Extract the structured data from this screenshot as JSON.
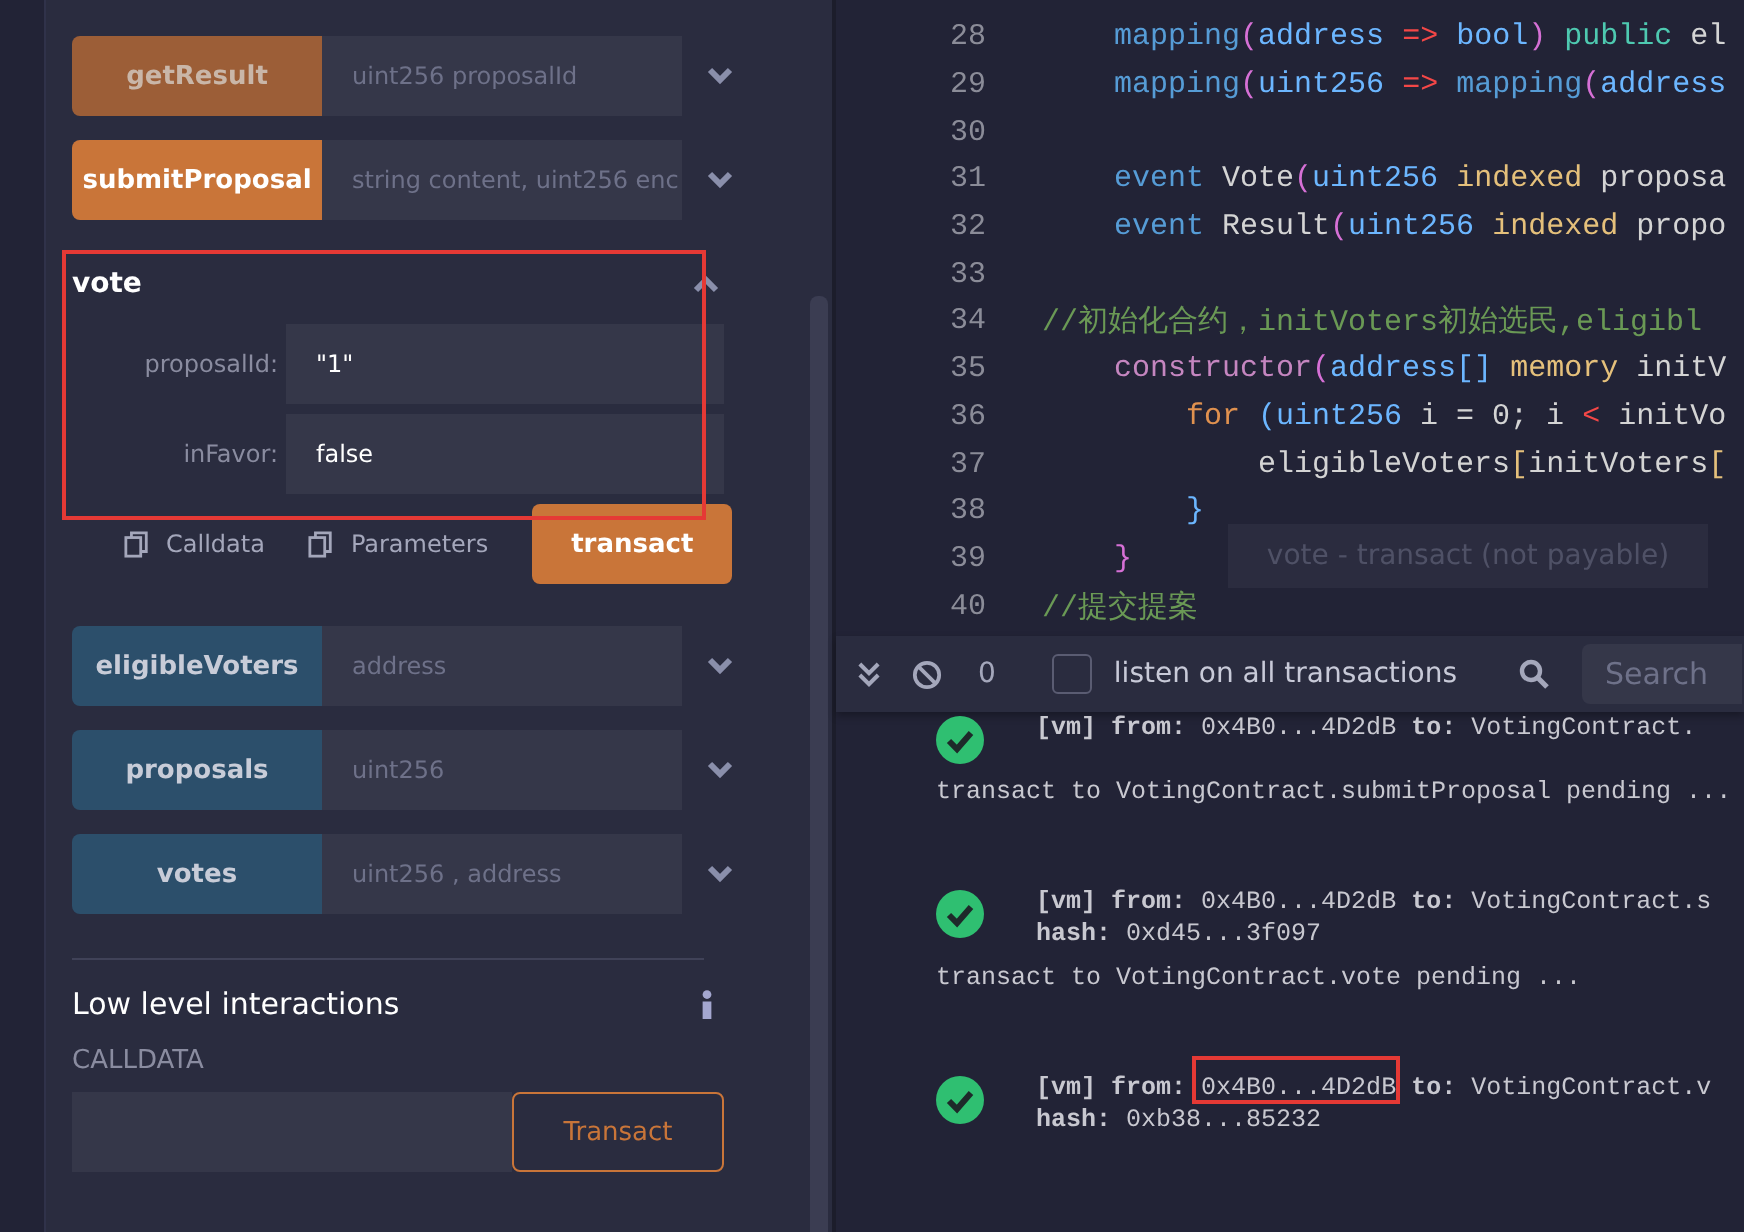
{
  "functions": [
    {
      "name": "getResult",
      "kind": "muted",
      "expanded": false,
      "placeholder": "uint256 proposalId"
    },
    {
      "name": "submitProposal",
      "kind": "transact",
      "expanded": false,
      "placeholder": "string content, uint256 enc"
    },
    {
      "name": "vote",
      "kind": "transact",
      "expanded": true,
      "params": [
        {
          "label": "proposalId:",
          "value": "\"1\""
        },
        {
          "label": "inFavor:",
          "value": "false"
        }
      ],
      "actions": [
        "Calldata",
        "Parameters"
      ],
      "button": "transact"
    },
    {
      "name": "eligibleVoters",
      "kind": "call",
      "expanded": false,
      "placeholder": "address"
    },
    {
      "name": "proposals",
      "kind": "call",
      "expanded": false,
      "placeholder": "uint256"
    },
    {
      "name": "votes",
      "kind": "call",
      "expanded": false,
      "placeholder": "uint256 , address"
    }
  ],
  "low_level": {
    "title": "Low level interactions",
    "label": "CALLDATA",
    "button": "Transact"
  },
  "tooltip": "vote - transact (not payable)",
  "editor": {
    "lines": [
      {
        "number": "28",
        "tokens": [
          {
            "t": "    mapping",
            "kind": "kw"
          },
          {
            "t": "(",
            "kind": "paren"
          },
          {
            "t": "address ",
            "kind": "type"
          },
          {
            "t": "=>",
            "kind": "op"
          },
          {
            "t": " bool",
            "kind": "type"
          },
          {
            "t": ")",
            "kind": "paren"
          },
          {
            "t": " public",
            "kind": "pub"
          },
          {
            "t": " el",
            "kind": "id"
          }
        ]
      },
      {
        "number": "29",
        "tokens": [
          {
            "t": "    mapping",
            "kind": "kw"
          },
          {
            "t": "(",
            "kind": "paren"
          },
          {
            "t": "uint256 ",
            "kind": "type"
          },
          {
            "t": "=>",
            "kind": "op"
          },
          {
            "t": " mapping",
            "kind": "kw"
          },
          {
            "t": "(",
            "kind": "paren"
          },
          {
            "t": "address",
            "kind": "type"
          }
        ]
      },
      {
        "number": "30"
      },
      {
        "number": "31",
        "tokens": [
          {
            "t": "    event",
            "kind": "kw"
          },
          {
            "t": " Vote",
            "kind": "id"
          },
          {
            "t": "(",
            "kind": "paren"
          },
          {
            "t": "uint256 ",
            "kind": "type"
          },
          {
            "t": "indexed",
            "kind": "mod"
          },
          {
            "t": " proposa",
            "kind": "id"
          }
        ]
      },
      {
        "number": "32",
        "tokens": [
          {
            "t": "    event",
            "kind": "kw"
          },
          {
            "t": " Result",
            "kind": "id"
          },
          {
            "t": "(",
            "kind": "paren"
          },
          {
            "t": "uint256 ",
            "kind": "type"
          },
          {
            "t": "indexed",
            "kind": "mod"
          },
          {
            "t": " propo",
            "kind": "id"
          }
        ]
      },
      {
        "number": "33"
      },
      {
        "number": "34",
        "tokens": [
          {
            "t": "//初始化合约，initVoters初始选民,eligibl",
            "kind": "cm"
          }
        ]
      },
      {
        "number": "35",
        "tokens": [
          {
            "t": "    constructor",
            "kind": "ctor"
          },
          {
            "t": "(",
            "kind": "paren"
          },
          {
            "t": "address[]",
            "kind": "type"
          },
          {
            "t": " memory",
            "kind": "mod"
          },
          {
            "t": " initV",
            "kind": "id"
          }
        ]
      },
      {
        "number": "36",
        "tokens": [
          {
            "t": "        for",
            "kind": "ctrl"
          },
          {
            "t": " (uint256",
            "kind": "type"
          },
          {
            "t": " i = 0; i ",
            "kind": "id"
          },
          {
            "t": "<",
            "kind": "op"
          },
          {
            "t": " initVo",
            "kind": "id"
          }
        ]
      },
      {
        "number": "37",
        "tokens": [
          {
            "t": "            eligibleVoters",
            "kind": "id"
          },
          {
            "t": "[",
            "kind": "mod"
          },
          {
            "t": "initVoters",
            "kind": "id"
          },
          {
            "t": "[",
            "kind": "mod"
          }
        ]
      },
      {
        "number": "38",
        "tokens": [
          {
            "t": "        }",
            "kind": "type"
          }
        ]
      },
      {
        "number": "39",
        "tokens": [
          {
            "t": "    }",
            "kind": "paren"
          }
        ]
      },
      {
        "number": "40",
        "tokens": [
          {
            "t": "//提交提案",
            "kind": "cm"
          }
        ]
      }
    ]
  },
  "terminal": {
    "count": "0",
    "listen_checked": false,
    "listen_label": "listen on all transactions",
    "search_placeholder": "Search",
    "entries": [
      {
        "kind": "tx",
        "header": "**[vm]**  **from:** 0x4B0...4D2dB **to:** VotingContract."
      },
      {
        "kind": "msg",
        "text": "transact to VotingContract.submitProposal pending ..."
      },
      {
        "kind": "tx",
        "header": "**[vm]**  **from:** 0x4B0...4D2dB **to:** VotingContract.s",
        "hash": "**hash:** 0xd45...3f097"
      },
      {
        "kind": "msg",
        "text": "transact to VotingContract.vote pending ..."
      },
      {
        "kind": "tx",
        "header": "**[vm]**  **from:** 0x4B0...4D2dB **to:** VotingContract.v",
        "hash": "**hash:** 0xb38...85232"
      }
    ]
  }
}
